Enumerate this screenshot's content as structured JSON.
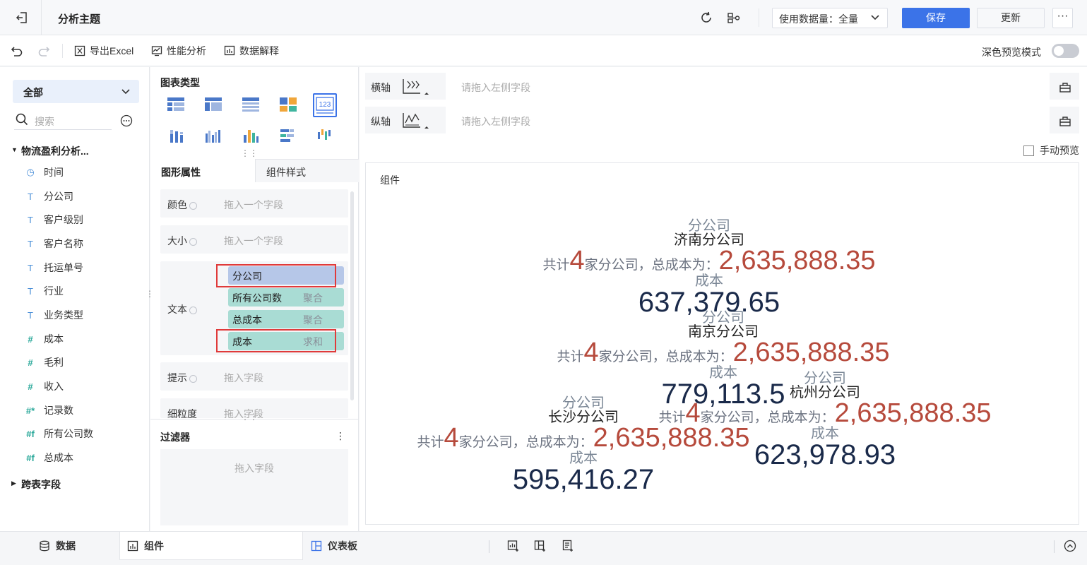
{
  "header": {
    "title": "分析主题",
    "data_amount": "使用数据量：全量",
    "save": "保存",
    "update": "更新",
    "more": "···"
  },
  "toolbar": {
    "export_excel": "导出Excel",
    "perf": "性能分析",
    "explain": "数据解释",
    "dark_preview": "深色预览模式"
  },
  "left": {
    "scope": "全部",
    "search_placeholder": "搜索",
    "folder": "物流盈利分析...",
    "fields": [
      {
        "icon": "clock-icon",
        "label": "时间"
      },
      {
        "icon": "text-type-icon",
        "label": "分公司"
      },
      {
        "icon": "text-type-icon",
        "label": "客户级别"
      },
      {
        "icon": "text-type-icon",
        "label": "客户名称"
      },
      {
        "icon": "text-type-icon",
        "label": "托运单号"
      },
      {
        "icon": "text-type-icon",
        "label": "行业"
      },
      {
        "icon": "text-type-icon",
        "label": "业务类型"
      },
      {
        "icon": "number-type-icon",
        "label": "成本"
      },
      {
        "icon": "number-type-icon",
        "label": "毛利"
      },
      {
        "icon": "number-type-icon",
        "label": "收入"
      },
      {
        "icon": "computed-number-icon",
        "label": "记录数"
      },
      {
        "icon": "computed-number-icon",
        "label": "所有公司数"
      },
      {
        "icon": "computed-number-icon",
        "label": "总成本"
      }
    ],
    "cross_fields": "跨表字段"
  },
  "middle": {
    "chart_type_title": "图表类型",
    "tab_props": "图形属性",
    "tab_style": "组件样式",
    "color_label": "颜色",
    "color_ph": "拖入一个字段",
    "size_label": "大小",
    "size_ph": "拖入一个字段",
    "text_label": "文本",
    "chips": [
      {
        "label": "分公司",
        "agg": ""
      },
      {
        "label": "所有公司数",
        "agg": "聚合"
      },
      {
        "label": "总成本",
        "agg": "聚合"
      },
      {
        "label": "成本",
        "agg": "求和"
      }
    ],
    "tip_label": "提示",
    "tip_ph": "拖入字段",
    "granularity_label": "细粒度",
    "granularity_ph": "拖入字段",
    "filter_title": "过滤器",
    "filter_ph": "拖入字段"
  },
  "right": {
    "x_axis": "横轴",
    "y_axis": "纵轴",
    "axis_ph": "请拖入左侧字段",
    "manual_preview": "手动预览",
    "canvas_caption": "组件",
    "cards": [
      {
        "field_label": "分公司",
        "branch": "济南分公司",
        "prefix": "共计",
        "count": "4",
        "middle": "家分公司，总成本为：",
        "total": "2,635,888.35",
        "cost_label": "成本",
        "cost": "637,379.65"
      },
      {
        "field_label": "分公司",
        "branch": "南京分公司",
        "prefix": "共计",
        "count": "4",
        "middle": "家分公司，总成本为：",
        "total": "2,635,888.35",
        "cost_label": "成本",
        "cost": "779,113.5"
      },
      {
        "field_label": "分公司",
        "branch": "杭州分公司",
        "prefix": "共计",
        "count": "4",
        "middle": "家分公司，总成本为：",
        "total": "2,635,888.35",
        "cost_label": "成本",
        "cost": "623,978.93"
      },
      {
        "field_label": "分公司",
        "branch": "长沙分公司",
        "prefix": "共计",
        "count": "4",
        "middle": "家分公司，总成本为：",
        "total": "2,635,888.35",
        "cost_label": "成本",
        "cost": "595,416.27"
      }
    ]
  },
  "bottom": {
    "data_tab": "数据",
    "component_tab": "组件",
    "dashboard_tab": "仪表板"
  },
  "colors": {
    "primary": "#3b73e8",
    "total_red": "#b64a3c",
    "cost_navy": "#1a2a4a",
    "chip_blue": "#b6c7e8",
    "chip_green": "#a9dcd4",
    "highlight_red": "#e03a3a"
  }
}
